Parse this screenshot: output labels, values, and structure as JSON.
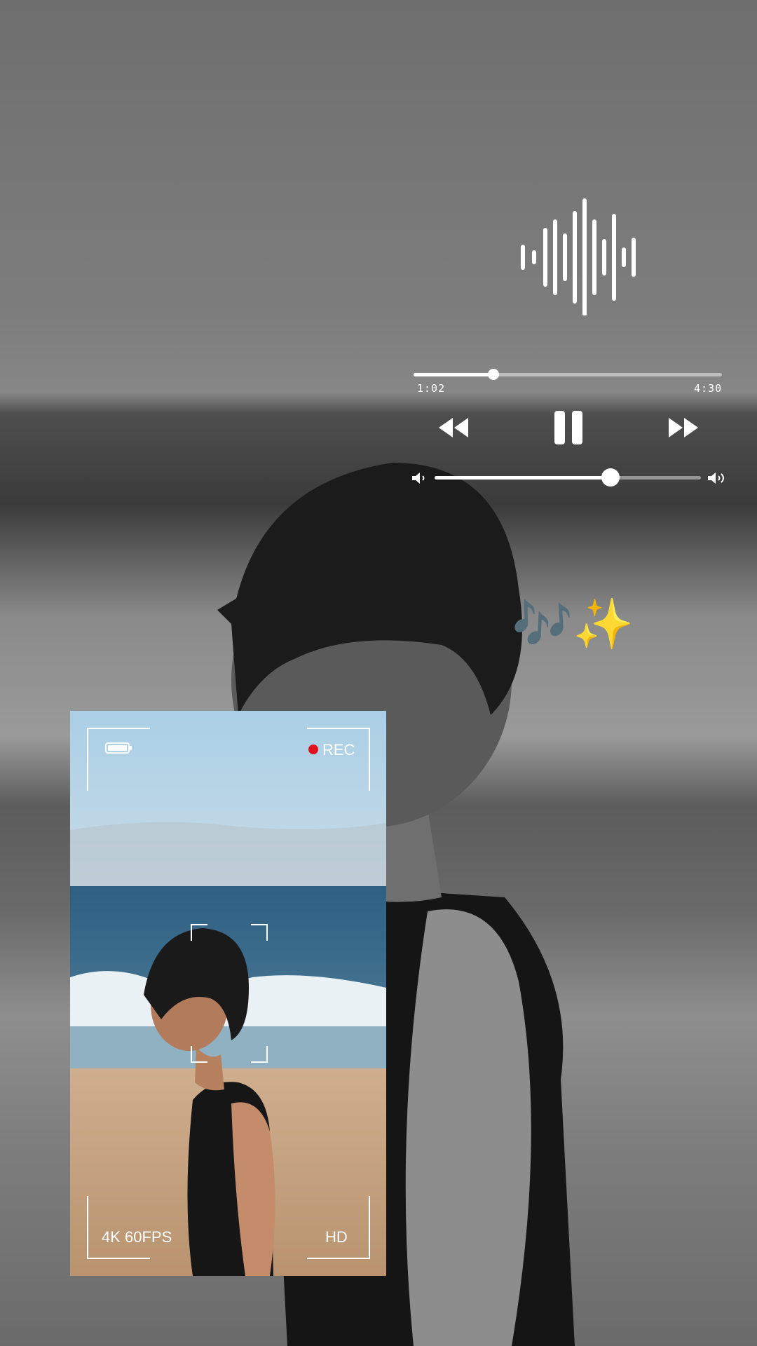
{
  "player": {
    "elapsed": "1:02",
    "total": "4:30",
    "progress": 0.26,
    "volume": 0.66
  },
  "sticker": {
    "emojis": "🎶✨"
  },
  "camera": {
    "rec_label": "REC",
    "format_label": "4K 60FPS",
    "quality_label": "HD"
  },
  "colors": {
    "rec_dot": "#e0141e",
    "controls": "#ffffff"
  },
  "icons": [
    "waveform-icon",
    "rewind-icon",
    "pause-icon",
    "fast-forward-icon",
    "volume-low-icon",
    "volume-high-icon",
    "battery-icon"
  ]
}
